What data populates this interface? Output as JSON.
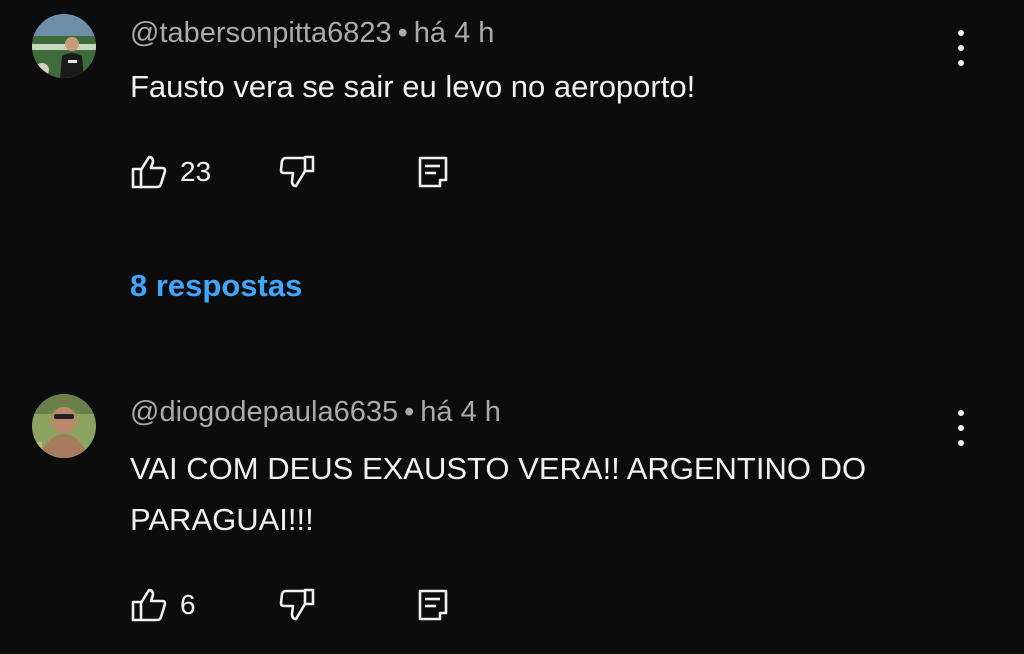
{
  "comments": [
    {
      "handle": "@tabersonpitta6823",
      "separator": "•",
      "time": "há 4 h",
      "text": "Fausto vera se sair eu levo no aeroporto!",
      "likes": "23",
      "replies_link": "8 respostas"
    },
    {
      "handle": "@diogodepaula6635",
      "separator": "•",
      "time": "há 4 h",
      "text": "VAI COM DEUS EXAUSTO VERA!! ARGENTINO DO PARAGUAI!!!",
      "likes": "6"
    }
  ],
  "colors": {
    "background": "#0c0c0c",
    "text": "#f1f1f1",
    "meta": "#aaaaaa",
    "link": "#3ea6ff"
  },
  "icons": {
    "like": "thumbs-up-icon",
    "dislike": "thumbs-down-icon",
    "reply": "comment-icon",
    "menu": "more-vert-icon"
  }
}
